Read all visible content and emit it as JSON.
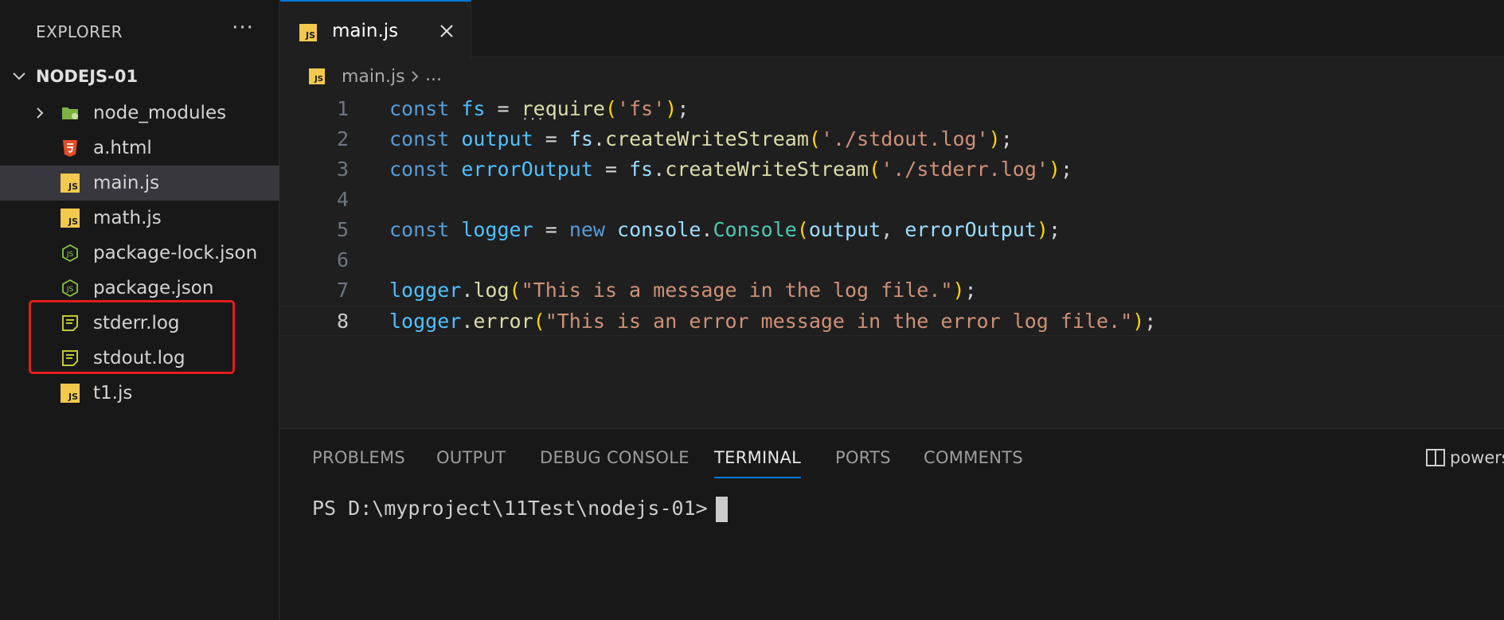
{
  "sidebar": {
    "title": "EXPLORER",
    "more": "···",
    "project": "NODEJS-01",
    "files": [
      {
        "name": "node_modules",
        "icon": "folder-icon"
      },
      {
        "name": "a.html",
        "icon": "html-icon"
      },
      {
        "name": "main.js",
        "icon": "js-icon"
      },
      {
        "name": "math.js",
        "icon": "js-icon"
      },
      {
        "name": "package-lock.json",
        "icon": "json-icon"
      },
      {
        "name": "package.json",
        "icon": "json-icon"
      },
      {
        "name": "stderr.log",
        "icon": "log-icon"
      },
      {
        "name": "stdout.log",
        "icon": "log-icon"
      },
      {
        "name": "t1.js",
        "icon": "js-icon"
      }
    ]
  },
  "tab": {
    "label": "main.js",
    "icon_text": "JS"
  },
  "breadcrumb": {
    "file": "main.js",
    "more": "..."
  },
  "code": {
    "lines": [
      "1",
      "2",
      "3",
      "4",
      "5",
      "6",
      "7",
      "8"
    ],
    "current_line": "8"
  },
  "panel": {
    "tabs": [
      "PROBLEMS",
      "OUTPUT",
      "DEBUG CONSOLE",
      "TERMINAL",
      "PORTS",
      "COMMENTS"
    ],
    "active_tab": "TERMINAL",
    "shell": "powershell",
    "prompt": "PS D:\\myproject\\11Test\\nodejs-01>"
  },
  "colors": {
    "accent": "#0078d4",
    "highlight_box": "#e31d1d",
    "js_icon": "#f2c94c"
  }
}
